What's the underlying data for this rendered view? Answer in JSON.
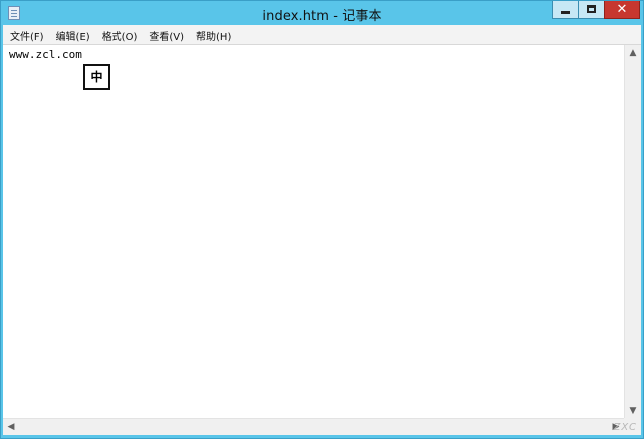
{
  "window": {
    "title": "index.htm - 记事本",
    "controls": {
      "minimize": "",
      "maximize": "",
      "close": "✕"
    }
  },
  "menu": {
    "items": [
      {
        "label": "文件(F)"
      },
      {
        "label": "编辑(E)"
      },
      {
        "label": "格式(O)"
      },
      {
        "label": "查看(V)"
      },
      {
        "label": "帮助(H)"
      }
    ]
  },
  "document": {
    "text": "www.zcl.com"
  },
  "ime": {
    "mode": "中"
  },
  "scrollbars": {
    "up": "▲",
    "down": "▼",
    "left": "◀",
    "right": "▶"
  },
  "watermark": "ZXC"
}
